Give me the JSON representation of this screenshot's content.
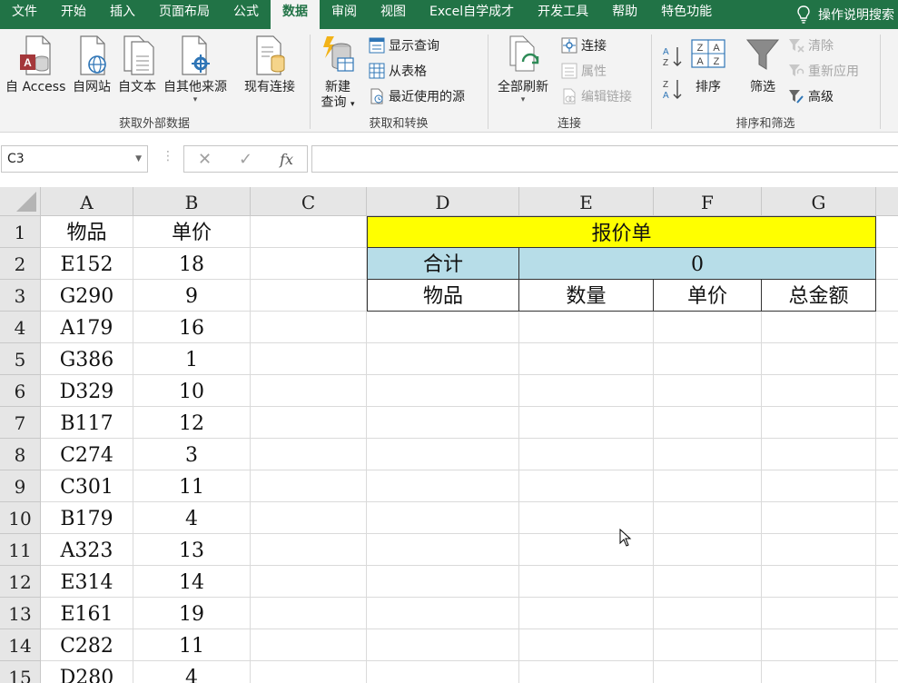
{
  "tabs": [
    {
      "label": "文件",
      "active": false
    },
    {
      "label": "开始",
      "active": false
    },
    {
      "label": "插入",
      "active": false
    },
    {
      "label": "页面布局",
      "active": false
    },
    {
      "label": "公式",
      "active": false
    },
    {
      "label": "数据",
      "active": true
    },
    {
      "label": "审阅",
      "active": false
    },
    {
      "label": "视图",
      "active": false
    },
    {
      "label": "Excel自学成才",
      "active": false
    },
    {
      "label": "开发工具",
      "active": false
    },
    {
      "label": "帮助",
      "active": false
    },
    {
      "label": "特色功能",
      "active": false
    }
  ],
  "tell_me": "操作说明搜索",
  "ribbon": {
    "get_external": {
      "label": "获取外部数据",
      "access": "自 Access",
      "web": "自网站",
      "text": "自文本",
      "other": "自其他来源",
      "existing": "现有连接"
    },
    "get_transform": {
      "label": "获取和转换",
      "new_query_line1": "新建",
      "new_query_line2": "查询",
      "show_queries": "显示查询",
      "from_table": "从表格",
      "recent_sources": "最近使用的源"
    },
    "connections": {
      "label": "连接",
      "refresh_all": "全部刷新",
      "connections": "连接",
      "properties": "属性",
      "edit_links": "编辑链接"
    },
    "sort_filter": {
      "label": "排序和筛选",
      "sort": "排序",
      "filter": "筛选",
      "clear": "清除",
      "reapply": "重新应用",
      "advanced": "高级"
    }
  },
  "formula_bar": {
    "name_box": "C3",
    "fx": "fx",
    "formula": ""
  },
  "colors": {
    "accent": "#217346",
    "title_fill": "#ffff00",
    "total_fill": "#b7dde8"
  },
  "columns": [
    "A",
    "B",
    "C",
    "D",
    "E",
    "F",
    "G"
  ],
  "rows": [
    "1",
    "2",
    "3",
    "4",
    "5",
    "6",
    "7",
    "8",
    "9",
    "10",
    "11",
    "12",
    "13",
    "14",
    "15"
  ],
  "sheet": {
    "header": {
      "item": "物品",
      "price": "单价"
    },
    "items": [
      {
        "item": "E152",
        "price": "18"
      },
      {
        "item": "G290",
        "price": "9"
      },
      {
        "item": "A179",
        "price": "16"
      },
      {
        "item": "G386",
        "price": "1"
      },
      {
        "item": "D329",
        "price": "10"
      },
      {
        "item": "B117",
        "price": "12"
      },
      {
        "item": "C274",
        "price": "3"
      },
      {
        "item": "C301",
        "price": "11"
      },
      {
        "item": "B179",
        "price": "4"
      },
      {
        "item": "A323",
        "price": "13"
      },
      {
        "item": "E314",
        "price": "14"
      },
      {
        "item": "E161",
        "price": "19"
      },
      {
        "item": "C282",
        "price": "11"
      },
      {
        "item": "D280",
        "price": "4"
      }
    ]
  },
  "quote": {
    "title": "报价单",
    "total_label": "合计",
    "total_value": "0",
    "headers": [
      "物品",
      "数量",
      "单价",
      "总金额"
    ]
  }
}
